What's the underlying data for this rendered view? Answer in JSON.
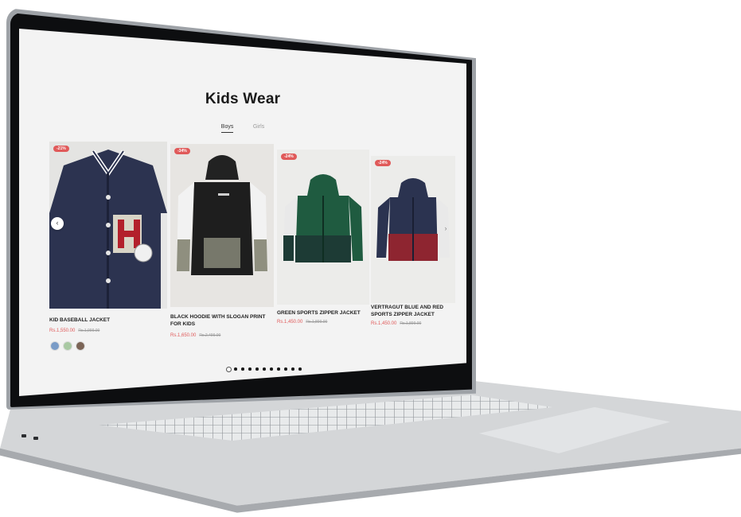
{
  "page": {
    "title": "Kids Wear",
    "tabs": [
      {
        "label": "Boys",
        "active": true
      },
      {
        "label": "Girls",
        "active": false
      }
    ]
  },
  "products": [
    {
      "name": "KID BASEBALL JACKET",
      "price": "Rs.1,550.00",
      "old_price": "Rs.1,999.00",
      "badge": "-21%",
      "swatches": [
        "#7a9cc7",
        "#a9c9a3",
        "#7b6456"
      ]
    },
    {
      "name": "BLACK HOODIE WITH SLOGAN PRINT FOR KIDS",
      "price": "Rs.1,650.00",
      "old_price": "Rs.2,499.00",
      "badge": "-34%"
    },
    {
      "name": "GREEN SPORTS ZIPPER JACKET",
      "price": "Rs.1,450.00",
      "old_price": "Rs.1,899.00",
      "badge": "-24%"
    },
    {
      "name": "VERTRAGUT BLUE AND RED SPORTS ZIPPER JACKET",
      "price": "Rs.1,450.00",
      "old_price": "Rs.1,899.00",
      "badge": "-24%"
    }
  ],
  "carousel": {
    "prev_icon": "chevron-left-icon",
    "next_icon": "chevron-right-icon",
    "prev_glyph": "‹",
    "next_glyph": "›",
    "page_count": 11,
    "active_page": 1
  },
  "colors": {
    "accent": "#e05a5a",
    "page_bg": "#f3f3f3"
  }
}
